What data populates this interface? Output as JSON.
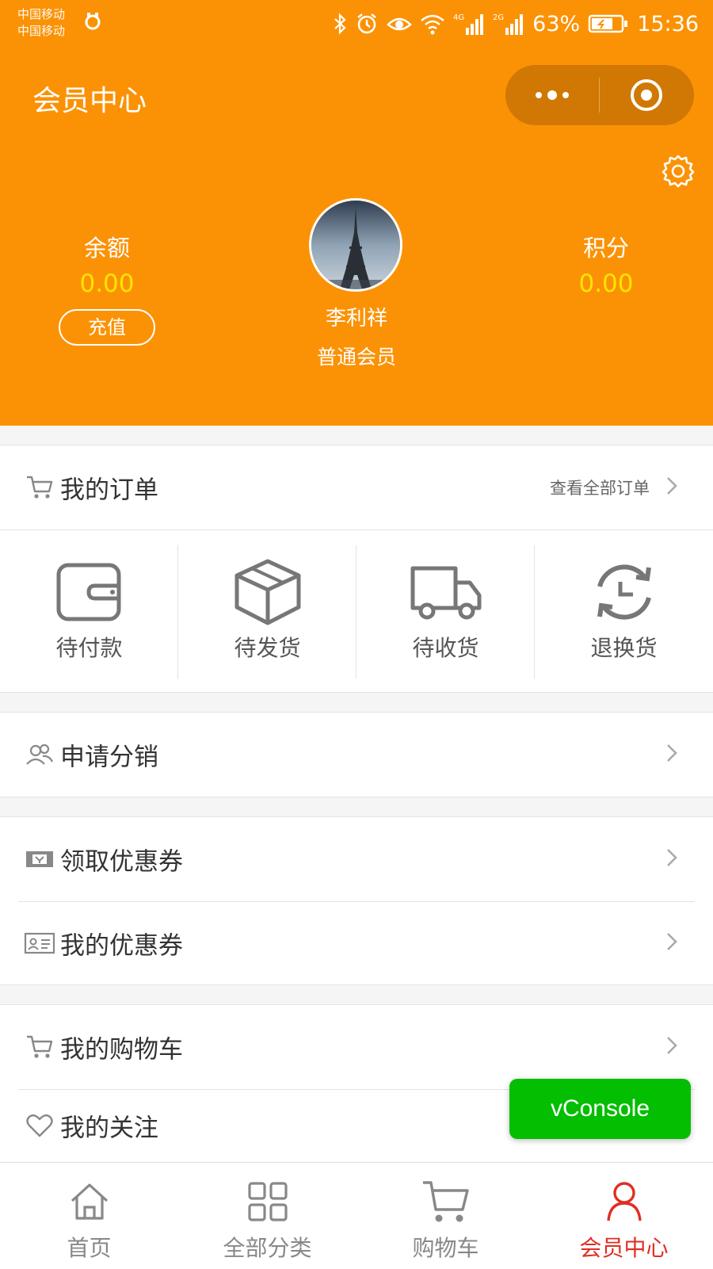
{
  "status_bar": {
    "carrier_1": "中国移动",
    "carrier_2": "中国移动",
    "network_1": "4G",
    "network_2": "2G",
    "battery": "63%",
    "time": "15:36"
  },
  "header": {
    "title": "会员中心",
    "balance": {
      "label": "余额",
      "value": "0.00",
      "button": "充值"
    },
    "points": {
      "label": "积分",
      "value": "0.00"
    },
    "user": {
      "name": "李利祥",
      "level": "普通会员"
    }
  },
  "orders": {
    "title": "我的订单",
    "view_all": "查看全部订单",
    "statuses": [
      {
        "label": "待付款",
        "icon": "wallet-icon"
      },
      {
        "label": "待发货",
        "icon": "box-icon"
      },
      {
        "label": "待收货",
        "icon": "truck-icon"
      },
      {
        "label": "退换货",
        "icon": "exchange-icon"
      }
    ]
  },
  "menu": {
    "distribution": "申请分销",
    "get_coupons": "领取优惠券",
    "my_coupons": "我的优惠券",
    "my_cart": "我的购物车",
    "my_follow": "我的关注"
  },
  "vconsole": "vConsole",
  "tabbar": {
    "items": [
      {
        "label": "首页",
        "icon": "home-icon"
      },
      {
        "label": "全部分类",
        "icon": "grid-icon"
      },
      {
        "label": "购物车",
        "icon": "cart-icon"
      },
      {
        "label": "会员中心",
        "icon": "user-icon",
        "active": true
      }
    ]
  },
  "colors": {
    "header_bg": "#fb9205",
    "value_yellow": "#ffe400",
    "active_tab": "#e02e24",
    "vconsole_green": "#04be02"
  }
}
